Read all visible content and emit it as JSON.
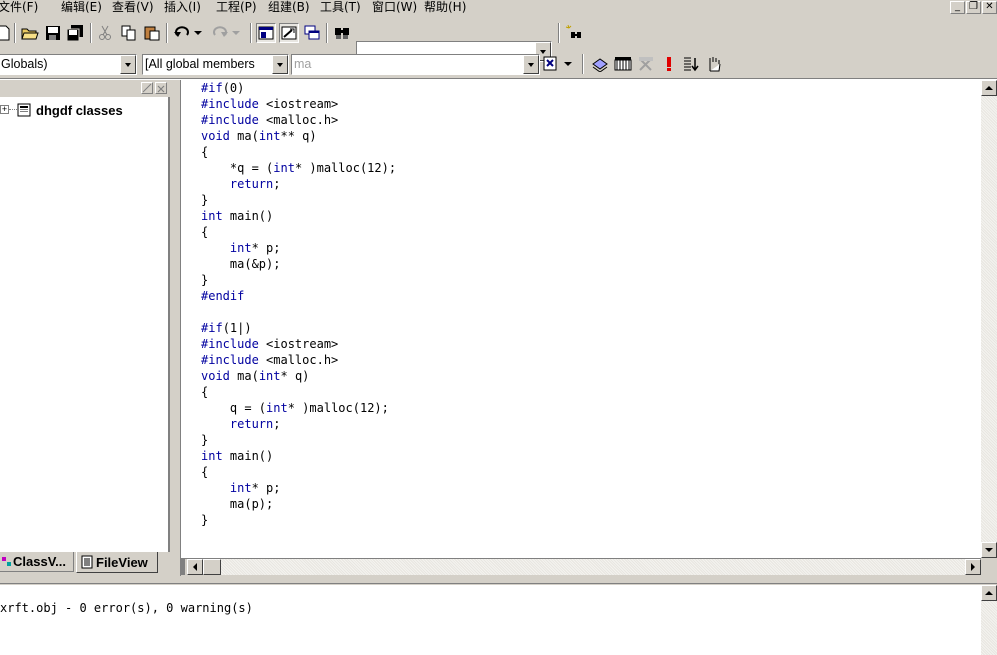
{
  "menu": [
    {
      "label": "文件(F)"
    },
    {
      "label": "编辑(E)"
    },
    {
      "label": "查看(V)"
    },
    {
      "label": "插入(I)"
    },
    {
      "label": "工程(P)"
    },
    {
      "label": "组建(B)"
    },
    {
      "label": "工具(T)"
    },
    {
      "label": "窗口(W)"
    },
    {
      "label": "帮助(H)"
    }
  ],
  "window_controls": {
    "minimize": "_",
    "restore": "❐",
    "close": "✕"
  },
  "toolbar1": {
    "find_combo_value": ""
  },
  "toolbar2": {
    "scope_combo": "Globals)",
    "members_combo": "[All global members",
    "function_combo": "ma"
  },
  "class_tree": {
    "root_label": "dhgdf classes",
    "expand_glyph": "+"
  },
  "tabs": {
    "classview": "ClassV...",
    "fileview": "FileView"
  },
  "code_lines": [
    [
      {
        "t": "#if",
        "k": 1
      },
      {
        "t": "(0)",
        "k": 0
      }
    ],
    [
      {
        "t": "#include",
        "k": 1
      },
      {
        "t": " <iostream>",
        "k": 0
      }
    ],
    [
      {
        "t": "#include",
        "k": 1
      },
      {
        "t": " <malloc.h>",
        "k": 0
      }
    ],
    [
      {
        "t": "void",
        "k": 1
      },
      {
        "t": " ma(",
        "k": 0
      },
      {
        "t": "int",
        "k": 1
      },
      {
        "t": "** q)",
        "k": 0
      }
    ],
    [
      {
        "t": "{",
        "k": 0
      }
    ],
    [
      {
        "t": "    *q = (",
        "k": 0
      },
      {
        "t": "int",
        "k": 1
      },
      {
        "t": "* )malloc(12);",
        "k": 0
      }
    ],
    [
      {
        "t": "    ",
        "k": 0
      },
      {
        "t": "return",
        "k": 1
      },
      {
        "t": ";",
        "k": 0
      }
    ],
    [
      {
        "t": "}",
        "k": 0
      }
    ],
    [
      {
        "t": "int",
        "k": 1
      },
      {
        "t": " main()",
        "k": 0
      }
    ],
    [
      {
        "t": "{",
        "k": 0
      }
    ],
    [
      {
        "t": "    ",
        "k": 0
      },
      {
        "t": "int",
        "k": 1
      },
      {
        "t": "* p;",
        "k": 0
      }
    ],
    [
      {
        "t": "    ma(&p);",
        "k": 0
      }
    ],
    [
      {
        "t": "}",
        "k": 0
      }
    ],
    [
      {
        "t": "#endif",
        "k": 1
      }
    ],
    [
      {
        "t": "",
        "k": 0
      }
    ],
    [
      {
        "t": "#if",
        "k": 1
      },
      {
        "t": "(1|)",
        "k": 0
      }
    ],
    [
      {
        "t": "#include",
        "k": 1
      },
      {
        "t": " <iostream>",
        "k": 0
      }
    ],
    [
      {
        "t": "#include",
        "k": 1
      },
      {
        "t": " <malloc.h>",
        "k": 0
      }
    ],
    [
      {
        "t": "void",
        "k": 1
      },
      {
        "t": " ma(",
        "k": 0
      },
      {
        "t": "int",
        "k": 1
      },
      {
        "t": "* q)",
        "k": 0
      }
    ],
    [
      {
        "t": "{",
        "k": 0
      }
    ],
    [
      {
        "t": "    q = (",
        "k": 0
      },
      {
        "t": "int",
        "k": 1
      },
      {
        "t": "* )malloc(12);",
        "k": 0
      }
    ],
    [
      {
        "t": "    ",
        "k": 0
      },
      {
        "t": "return",
        "k": 1
      },
      {
        "t": ";",
        "k": 0
      }
    ],
    [
      {
        "t": "}",
        "k": 0
      }
    ],
    [
      {
        "t": "int",
        "k": 1
      },
      {
        "t": " main()",
        "k": 0
      }
    ],
    [
      {
        "t": "{",
        "k": 0
      }
    ],
    [
      {
        "t": "    ",
        "k": 0
      },
      {
        "t": "int",
        "k": 1
      },
      {
        "t": "* p;",
        "k": 0
      }
    ],
    [
      {
        "t": "    ma(p);",
        "k": 0
      }
    ],
    [
      {
        "t": "}",
        "k": 0
      }
    ]
  ],
  "output": {
    "line": "xrft.obj - 0 error(s), 0 warning(s)"
  },
  "colors": {
    "keyword": "#0000a0",
    "face": "#d4d0c8"
  }
}
